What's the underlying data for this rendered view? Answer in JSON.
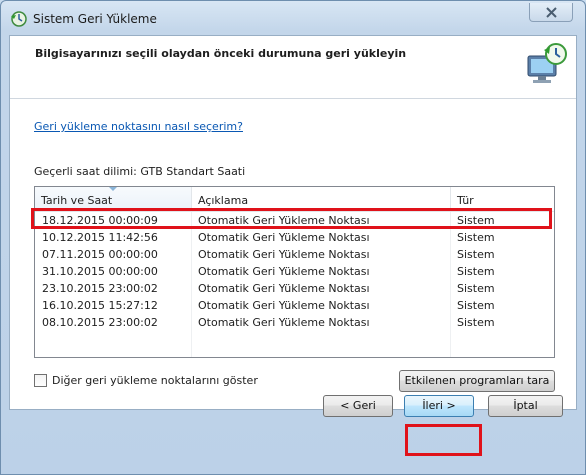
{
  "window": {
    "title": "Sistem Geri Yükleme"
  },
  "header": {
    "title": "Bilgisayarınızı seçili olaydan önceki durumuna geri yükleyin"
  },
  "help_link": "Geri yükleme noktasını nasıl seçerim?",
  "timezone_text": "Geçerli saat dilimi: GTB Standart Saati",
  "table": {
    "columns": [
      "Tarih ve Saat",
      "Açıklama",
      "Tür"
    ],
    "rows": [
      [
        "18.12.2015 00:00:09",
        "Otomatik Geri Yükleme Noktası",
        "Sistem"
      ],
      [
        "10.12.2015 11:42:56",
        "Otomatik Geri Yükleme Noktası",
        "Sistem"
      ],
      [
        "07.11.2015 00:00:00",
        "Otomatik Geri Yükleme Noktası",
        "Sistem"
      ],
      [
        "31.10.2015 00:00:00",
        "Otomatik Geri Yükleme Noktası",
        "Sistem"
      ],
      [
        "23.10.2015 23:00:02",
        "Otomatik Geri Yükleme Noktası",
        "Sistem"
      ],
      [
        "16.10.2015 15:27:12",
        "Otomatik Geri Yükleme Noktası",
        "Sistem"
      ],
      [
        "08.10.2015 23:00:02",
        "Otomatik Geri Yükleme Noktası",
        "Sistem"
      ]
    ]
  },
  "show_more_label": "Diğer geri yükleme noktalarını göster",
  "buttons": {
    "affected_programs": "Etkilenen programları tara",
    "back": "< Geri",
    "next": "İleri >",
    "cancel": "İptal"
  },
  "icons": {
    "title": "system-restore-icon",
    "header": "restore-monitor-icon",
    "close": "close-icon"
  },
  "colors": {
    "highlight": "#e0121a",
    "link": "#0a58b3"
  }
}
